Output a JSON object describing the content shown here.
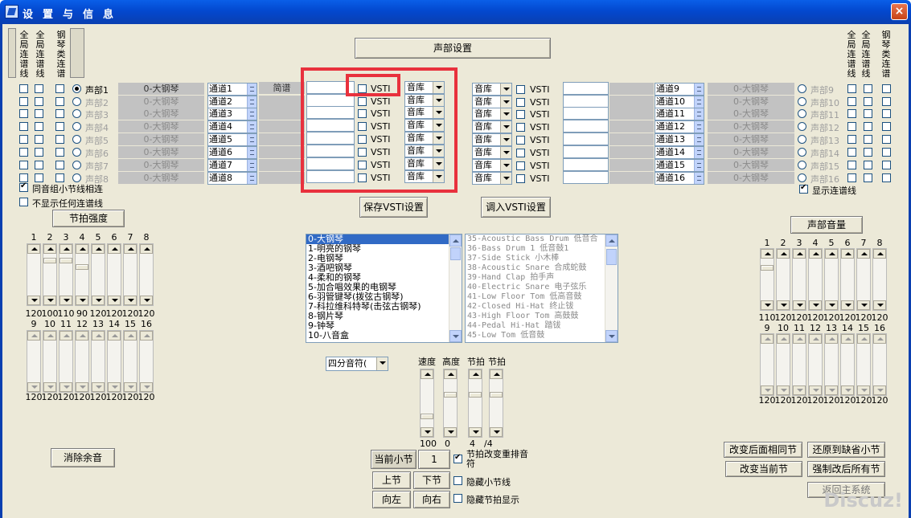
{
  "window": {
    "title": "设置与信息",
    "close": "×"
  },
  "header": {
    "part_settings": "声部设置",
    "left_cols": [
      "全局连谱线",
      "全局连谱线",
      "钢琴类连谱"
    ],
    "right_cols": [
      "全局连谱线",
      "全局连谱线",
      "钢琴类连谱"
    ],
    "jianpu": "简谱"
  },
  "left_parts": [
    {
      "label": "声部1",
      "instrument": "0-大钢琴",
      "channel": "通道1"
    },
    {
      "label": "声部2",
      "instrument": "0-大钢琴",
      "channel": "通道2"
    },
    {
      "label": "声部3",
      "instrument": "0-大钢琴",
      "channel": "通道3"
    },
    {
      "label": "声部4",
      "instrument": "0-大钢琴",
      "channel": "通道4"
    },
    {
      "label": "声部5",
      "instrument": "0-大钢琴",
      "channel": "通道5"
    },
    {
      "label": "声部6",
      "instrument": "0-大钢琴",
      "channel": "通道6"
    },
    {
      "label": "声部7",
      "instrument": "0-大钢琴",
      "channel": "通道7"
    },
    {
      "label": "声部8",
      "instrument": "0-大钢琴",
      "channel": "通道8"
    }
  ],
  "right_parts": [
    {
      "label": "声部9",
      "instrument": "0-大钢琴",
      "channel": "通道9"
    },
    {
      "label": "声部10",
      "instrument": "0-大钢琴",
      "channel": "通道10"
    },
    {
      "label": "声部11",
      "instrument": "0-大钢琴",
      "channel": "通道11"
    },
    {
      "label": "声部12",
      "instrument": "0-大钢琴",
      "channel": "通道12"
    },
    {
      "label": "声部13",
      "instrument": "0-大钢琴",
      "channel": "通道13"
    },
    {
      "label": "声部14",
      "instrument": "0-大钢琴",
      "channel": "通道14"
    },
    {
      "label": "声部15",
      "instrument": "0-大钢琴",
      "channel": "通道15"
    },
    {
      "label": "声部16",
      "instrument": "0-大钢琴",
      "channel": "通道16"
    }
  ],
  "vsti": {
    "label": "VSTI",
    "lib": "音库",
    "save": "保存VSTI设置",
    "load": "调入VSTI设置"
  },
  "options": {
    "same_group_link": "同音组小节线相连",
    "hide_all_links": "不显示任何连谱线",
    "show_links": "显示连谱线"
  },
  "beat_strength": {
    "title": "节拍强度",
    "top_nums": [
      "1",
      "2",
      "3",
      "4",
      "5",
      "6",
      "7",
      "8"
    ],
    "top_vals": [
      "120",
      "100",
      "110",
      "90",
      "120",
      "120",
      "120",
      "120"
    ],
    "bot_nums": [
      "9",
      "10",
      "11",
      "12",
      "13",
      "14",
      "15",
      "16"
    ],
    "bot_vals": [
      "120",
      "120",
      "120",
      "120",
      "120",
      "120",
      "120",
      "120"
    ]
  },
  "part_volume": {
    "title": "声部音量",
    "top_nums": [
      "1",
      "2",
      "3",
      "4",
      "5",
      "6",
      "7",
      "8"
    ],
    "top_vals": [
      "110",
      "120",
      "120",
      "120",
      "120",
      "120",
      "120",
      "120"
    ],
    "bot_nums": [
      "9",
      "10",
      "11",
      "12",
      "13",
      "14",
      "15",
      "16"
    ],
    "bot_vals": [
      "120",
      "120",
      "120",
      "120",
      "120",
      "120",
      "120",
      "120"
    ]
  },
  "instrument_list": [
    "0-大钢琴",
    "1-明亮的钢琴",
    "2-电钢琴",
    "3-酒吧钢琴",
    "4-柔和的钢琴",
    "5-加合唱效果的电钢琴",
    "6-羽管键琴(拨弦古钢琴)",
    "7-科拉维科特琴(击弦古钢琴)",
    "8-钢片琴",
    "9-钟琴",
    "10-八音盒"
  ],
  "drum_list": [
    "35-Acoustic Bass Drum  低音合",
    "36-Bass Drum 1 低音鼓1",
    "37-Side Stick 小木棒",
    "38-Acoustic Snare 合成蛇鼓",
    "39-Hand Clap 拍手声",
    "40-Electric Snare 电子弦乐",
    "41-Low Floor Tom 低高音鼓",
    "42-Closed Hi-Hat 终止钹",
    "43-High Floor Tom 高鼓鼓",
    "44-Pedal Hi-Hat 踏钹",
    "45-Low Tom 低音鼓"
  ],
  "note_select": "四分音符(",
  "tempo": {
    "labels": [
      "速度",
      "高度",
      "节拍",
      "节拍"
    ],
    "values": [
      "100",
      "0",
      "4",
      "/4"
    ]
  },
  "buttons": {
    "clear_reverb": "消除余音",
    "current_bar": "当前小节",
    "bar_value": "1",
    "prev_bar": "上节",
    "next_bar": "下节",
    "left": "向左",
    "right": "向右",
    "change_next_same": "改变后面相同节",
    "restore_default": "还原到缺省小节",
    "change_current": "改变当前节",
    "force_after_all": "强制改后所有节",
    "return_main": "返回主系统"
  },
  "checks": {
    "rearrange": "节拍改变重排音符",
    "hide_bar": "隐藏小节线",
    "hide_beat": "隐藏节拍显示"
  },
  "watermark": "Discuz!"
}
